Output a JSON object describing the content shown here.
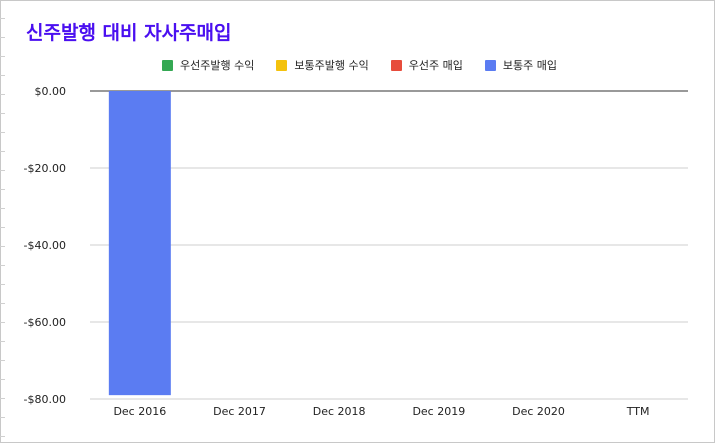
{
  "chart_data": {
    "type": "bar",
    "title": "신주발행 대비 자사주매입",
    "categories": [
      "Dec 2016",
      "Dec 2017",
      "Dec 2018",
      "Dec 2019",
      "Dec 2020",
      "TTM"
    ],
    "series": [
      {
        "name": "우선주발행 수익",
        "color": "#34a853",
        "values": [
          0,
          0,
          0,
          0,
          0,
          0
        ]
      },
      {
        "name": "보통주발행 수익",
        "color": "#f4c20d",
        "values": [
          0,
          0,
          0,
          0,
          0,
          0
        ]
      },
      {
        "name": "우선주 매입",
        "color": "#e74c3c",
        "values": [
          0,
          0,
          0,
          0,
          0,
          0
        ]
      },
      {
        "name": "보통주 매입",
        "color": "#5b7cf2",
        "values": [
          -79,
          0,
          0,
          0,
          0,
          0
        ]
      }
    ],
    "y_ticks": [
      "$0.00",
      "-$20.00",
      "-$40.00",
      "-$60.00",
      "-$80.00"
    ],
    "y_tick_values": [
      0,
      -20,
      -40,
      -60,
      -80
    ],
    "ylim": [
      -80,
      0
    ],
    "grid": true,
    "legend_position": "top"
  }
}
